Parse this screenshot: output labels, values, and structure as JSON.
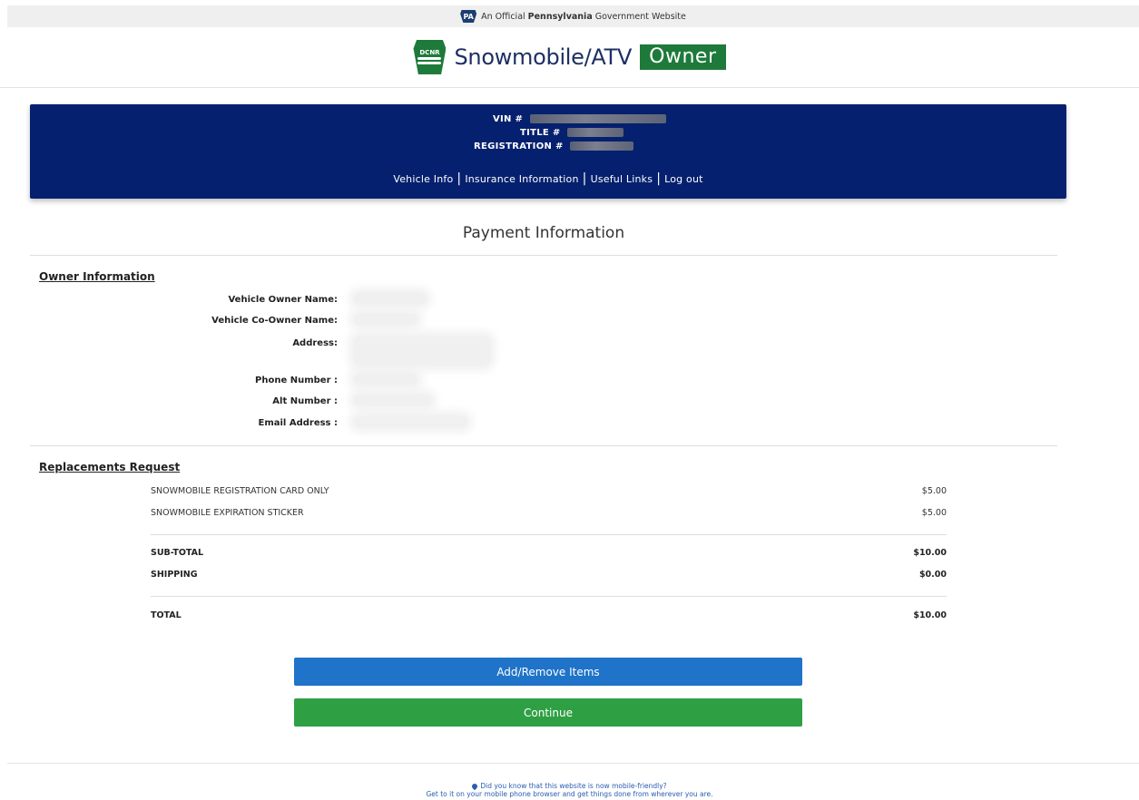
{
  "gov_bar": {
    "badge": "PA",
    "prefix": "An Official",
    "state": "Pennsylvania",
    "suffix": "Government Website"
  },
  "brand": {
    "logo_text": "DCNR",
    "title": "Snowmobile/ATV",
    "tag": "Owner"
  },
  "vehicle_panel": {
    "vin_label": "VIN #",
    "title_label": "TITLE #",
    "registration_label": "REGISTRATION #",
    "nav": [
      {
        "label": "Vehicle Info"
      },
      {
        "label": "Insurance Information"
      },
      {
        "label": "Useful Links"
      },
      {
        "label": "Log out"
      }
    ]
  },
  "payment": {
    "title": "Payment Information",
    "owner_section": {
      "heading": "Owner Information",
      "fields": [
        {
          "label": "Vehicle Owner Name:"
        },
        {
          "label": "Vehicle Co-Owner Name:"
        },
        {
          "label": "Address:"
        },
        {
          "label": "Phone Number :"
        },
        {
          "label": "Alt Number :"
        },
        {
          "label": "Email Address :"
        }
      ]
    },
    "replacements": {
      "heading": "Replacements Request",
      "items": [
        {
          "name": "SNOWMOBILE REGISTRATION CARD ONLY",
          "amount": "$5.00"
        },
        {
          "name": "SNOWMOBILE EXPIRATION STICKER",
          "amount": "$5.00"
        }
      ],
      "subtotal_label": "SUB-TOTAL",
      "subtotal": "$10.00",
      "shipping_label": "SHIPPING",
      "shipping": "$0.00",
      "total_label": "TOTAL",
      "total": "$10.00"
    },
    "buttons": {
      "add_remove": "Add/Remove Items",
      "continue": "Continue"
    }
  },
  "footer": {
    "line1": "Did you know that this website is now mobile-friendly?",
    "line2": "Get to it on your mobile phone browser and get things done from wherever you are."
  },
  "colors": {
    "panel_blue": "#05206e",
    "brand_green": "#1e7a3a",
    "button_blue": "#1f73c8",
    "button_green": "#2ea043"
  }
}
